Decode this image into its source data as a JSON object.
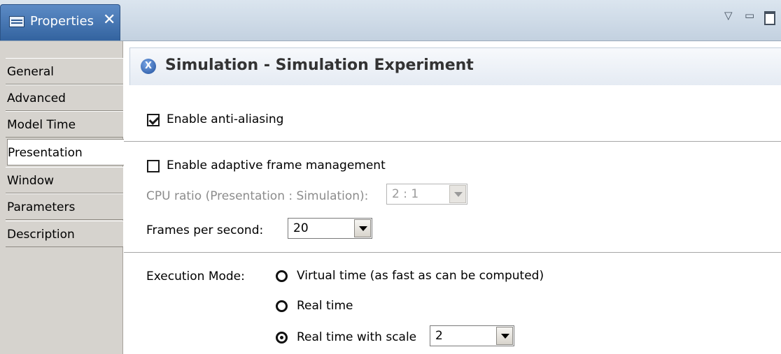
{
  "view": {
    "tab_label": "Properties",
    "close_glyph": "✕",
    "controls": [
      "view-menu-icon",
      "minimize-icon",
      "maximize-icon"
    ]
  },
  "sidebar": {
    "items": [
      {
        "label": "General",
        "active": false
      },
      {
        "label": "Advanced",
        "active": false
      },
      {
        "label": "Model Time",
        "active": false
      },
      {
        "label": "Presentation",
        "active": true
      },
      {
        "label": "Window",
        "active": false
      },
      {
        "label": "Parameters",
        "active": false
      },
      {
        "label": "Description",
        "active": false
      }
    ]
  },
  "header": {
    "icon": "simulation-experiment-icon",
    "icon_glyph": "X",
    "title": "Simulation - Simulation Experiment"
  },
  "form": {
    "anti_aliasing": {
      "label": "Enable anti-aliasing",
      "checked": true
    },
    "adaptive_frames": {
      "label": "Enable adaptive frame management",
      "checked": false
    },
    "cpu_ratio": {
      "label": "CPU ratio (Presentation : Simulation):",
      "value": "2 : 1",
      "enabled": false
    },
    "fps": {
      "label": "Frames per second:",
      "value": "20"
    },
    "execution_mode": {
      "label": "Execution Mode:",
      "options": [
        {
          "label": "Virtual time (as fast as can be computed)",
          "selected": false
        },
        {
          "label": "Real time",
          "selected": false
        },
        {
          "label": "Real time with scale",
          "selected": true
        }
      ],
      "scale_value": "2"
    }
  }
}
